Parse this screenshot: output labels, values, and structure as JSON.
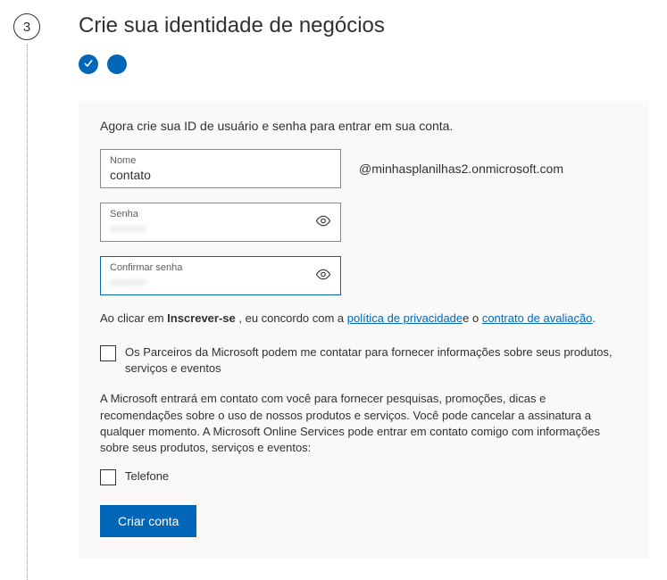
{
  "step": {
    "number": "3",
    "title": "Crie sua identidade de negócios"
  },
  "form": {
    "intro": "Agora crie sua ID de usuário e senha para entrar em sua conta.",
    "name": {
      "label": "Nome",
      "value": "contato"
    },
    "domain_suffix": "@minhasplanilhas2.onmicrosoft.com",
    "password": {
      "label": "Senha",
      "value": "•••••••"
    },
    "confirm_password": {
      "label": "Confirmar senha",
      "value": "•••••••"
    },
    "agreement": {
      "prefix": "Ao clicar em ",
      "action": "Inscrever-se",
      "middle": " , eu concordo com a ",
      "link1": "política de privacidade",
      "between": "e o ",
      "link2": "contrato de avaliação",
      "suffix": "."
    },
    "checkbox_partners": "Os Parceiros da Microsoft podem me contatar para fornecer informações sobre seus produtos, serviços e eventos",
    "contact_info": "A Microsoft entrará em contato com você para fornecer pesquisas, promoções, dicas e recomendações sobre o uso de nossos produtos e serviços. Você pode cancelar a assinatura a qualquer momento. A Microsoft Online Services pode entrar em contato comigo com informações sobre seus produtos, serviços e eventos:",
    "checkbox_phone": "Telefone",
    "submit": "Criar conta"
  }
}
